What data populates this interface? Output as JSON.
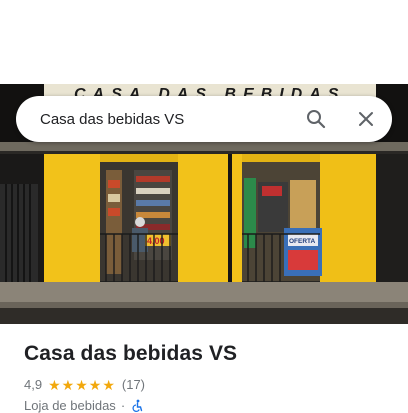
{
  "search": {
    "query": "Casa das bebidas VS"
  },
  "photo": {
    "sign_text": "CASA DAS BEBIDAS",
    "price_tag": "4,00",
    "poster_text": "OFERTA"
  },
  "place": {
    "name": "Casa das bebidas VS",
    "rating": "4,9",
    "stars": 5,
    "review_count": "(17)",
    "category": "Loja de bebidas",
    "separator": "·"
  },
  "colors": {
    "star": "#f2a80d",
    "wall_yellow": "#f2c21a",
    "text": "#202124",
    "muted": "#70757a"
  },
  "icons": [
    "search-icon",
    "close-icon",
    "star-icon",
    "wheelchair-accessible-icon"
  ]
}
